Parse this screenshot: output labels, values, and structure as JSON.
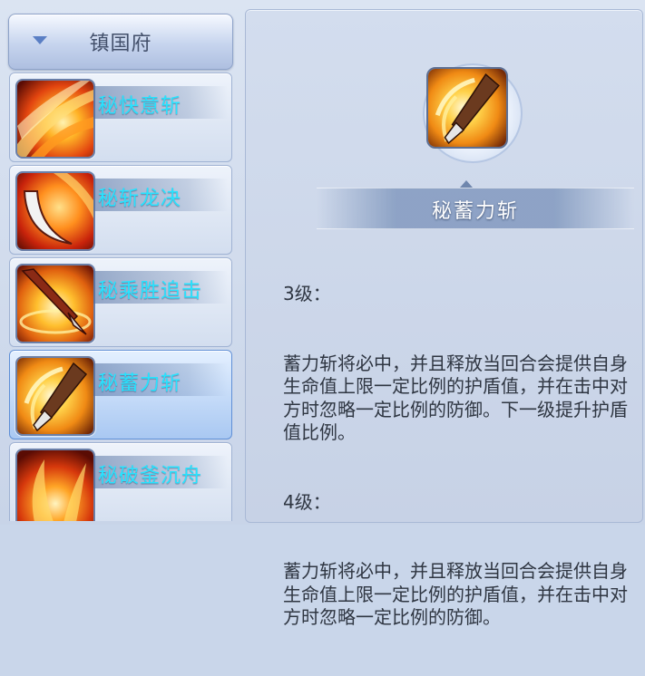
{
  "category": {
    "label": "镇国府"
  },
  "skills": [
    {
      "name": "秘快意斩",
      "icon": "fire-slash-icon"
    },
    {
      "name": "秘斩龙决",
      "icon": "crescent-blade-icon"
    },
    {
      "name": "秘乘胜追击",
      "icon": "flaming-spear-icon"
    },
    {
      "name": "秘蓄力斩",
      "icon": "charged-sword-icon",
      "selected": true
    },
    {
      "name": "秘破釜沉舟",
      "icon": "fire-burst-icon"
    }
  ],
  "detail": {
    "title": "秘蓄力斩",
    "icon": "charged-sword-icon",
    "entries": [
      {
        "level": "3级：",
        "text": "蓄力斩将必中，并且释放当回合会提供自身生命值上限一定比例的护盾值，并在击中对方时忽略一定比例的防御。下一级提升护盾值比例。"
      },
      {
        "level": "4级：",
        "text": "蓄力斩将必中，并且释放当回合会提供自身生命值上限一定比例的护盾值，并在击中对方时忽略一定比例的防御。"
      }
    ]
  },
  "colors": {
    "skill_name": "#27e3ff",
    "selected_bg": "#a9c8f2",
    "fire_orange": "#ff8a1a",
    "fire_red": "#c21a0a"
  }
}
